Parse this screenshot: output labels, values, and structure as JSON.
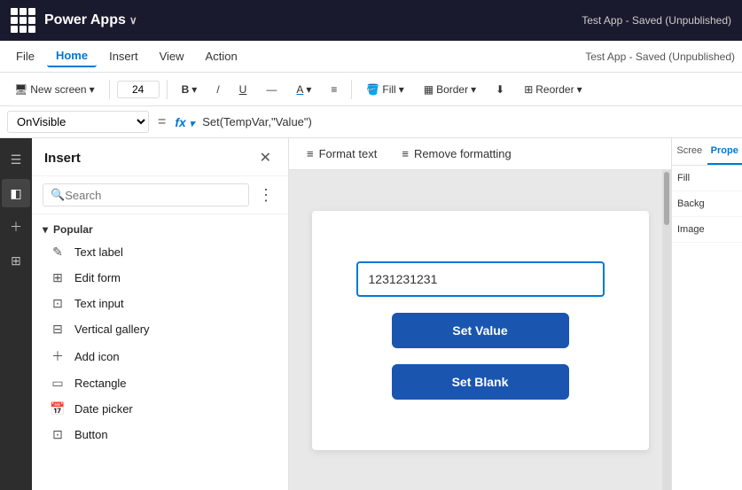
{
  "titlebar": {
    "app_name": "Power Apps",
    "chevron": "∨",
    "status": "Test App - Saved (Unpublished)"
  },
  "menubar": {
    "items": [
      "File",
      "Home",
      "Insert",
      "View",
      "Action"
    ],
    "active_index": 1
  },
  "toolbar": {
    "new_screen": "New screen",
    "font_size": "24",
    "bold": "B",
    "slash": "/",
    "underline": "U",
    "strikethrough": "—",
    "font_color": "A",
    "align": "≡",
    "fill": "Fill",
    "border": "Border",
    "reorder": "Reorder"
  },
  "formula_bar": {
    "property": "OnVisible",
    "equals": "=",
    "fx": "fx",
    "formula": "Set(TempVar,\"Value\")"
  },
  "insert_panel": {
    "title": "Insert",
    "search_placeholder": "Search",
    "section_popular": "Popular",
    "items": [
      {
        "icon": "text-label-icon",
        "label": "Text label"
      },
      {
        "icon": "edit-form-icon",
        "label": "Edit form"
      },
      {
        "icon": "text-input-icon",
        "label": "Text input"
      },
      {
        "icon": "vertical-gallery-icon",
        "label": "Vertical gallery"
      },
      {
        "icon": "add-icon",
        "label": "Add icon"
      },
      {
        "icon": "rectangle-icon",
        "label": "Rectangle"
      },
      {
        "icon": "date-picker-icon",
        "label": "Date picker"
      },
      {
        "icon": "button-icon",
        "label": "Button"
      }
    ]
  },
  "format_tabs": {
    "items": [
      {
        "label": "Format text",
        "icon": "≡"
      },
      {
        "label": "Remove formatting",
        "icon": "≡"
      }
    ]
  },
  "canvas": {
    "input_value": "1231231231",
    "btn1_label": "Set Value",
    "btn2_label": "Set Blank"
  },
  "right_panel": {
    "tab1": "Scree",
    "tab2": "Prope",
    "props": [
      "Fill",
      "Backg",
      "Image"
    ]
  }
}
